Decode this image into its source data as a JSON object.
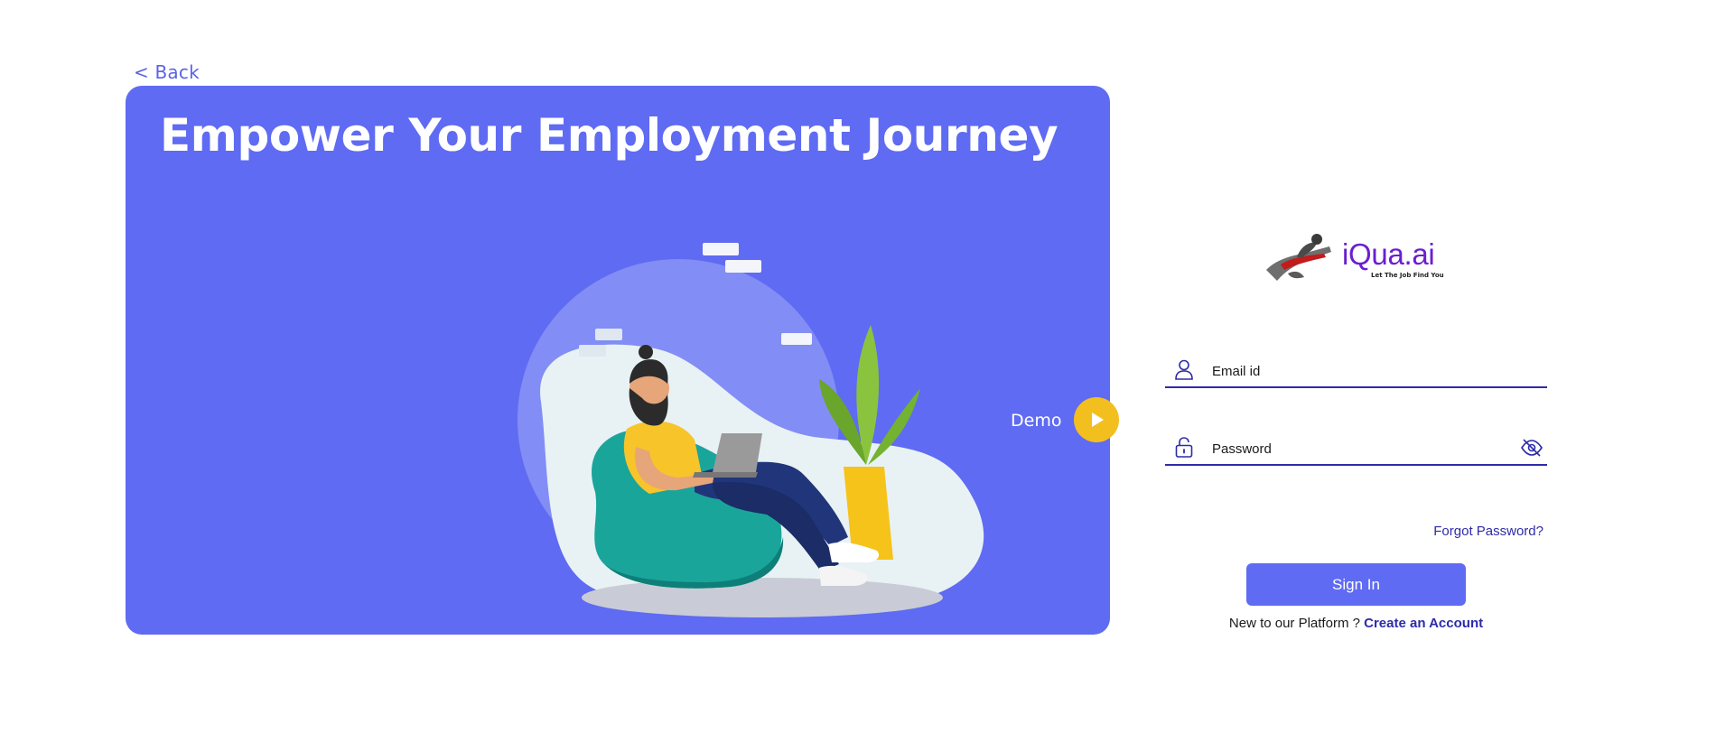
{
  "nav": {
    "back_label": "< Back"
  },
  "hero": {
    "title": "Empower Your Employment Journey",
    "demo_label": "Demo"
  },
  "brand": {
    "name": "iQua.ai",
    "tagline": "Let The Job Find You",
    "color": "#6a1fd1"
  },
  "form": {
    "email_placeholder": "Email id",
    "password_placeholder": "Password",
    "forgot_label": "Forgot Password?",
    "signin_label": "Sign In",
    "signup_prompt": "New to our Platform ? ",
    "signup_link": "Create an Account"
  },
  "icons": {
    "email": "user-icon",
    "password": "lock-icon",
    "visibility": "eye-off-icon",
    "demo": "play-icon"
  },
  "colors": {
    "accent": "#5f6bf2",
    "link": "#2e2ba9",
    "demo_button": "#f2bf1f"
  }
}
